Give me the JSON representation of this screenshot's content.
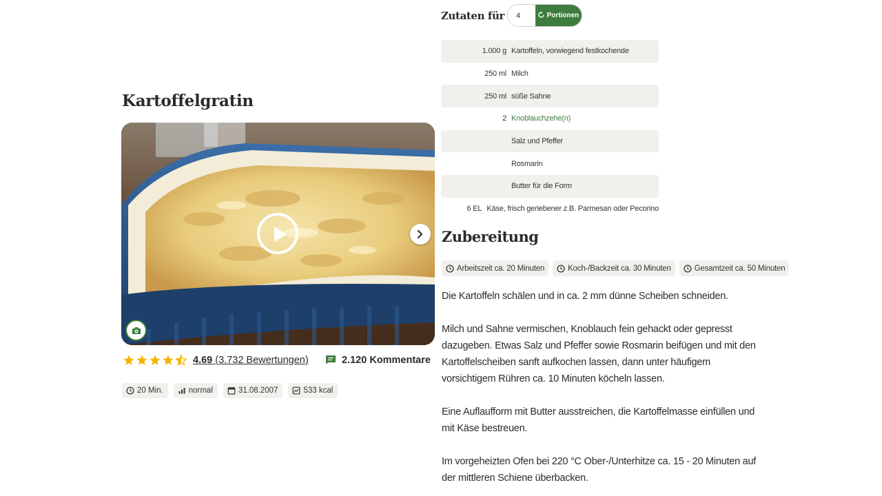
{
  "recipe": {
    "title": "Kartoffelgratin",
    "rating": {
      "average": "4.69",
      "count_text": "(3.732 Bewertungen)",
      "stars": 4.5
    },
    "comments_text": "2.120 Kommentare",
    "meta": [
      {
        "icon": "clock-icon",
        "text": "20 Min."
      },
      {
        "icon": "difficulty-icon",
        "text": "normal"
      },
      {
        "icon": "calendar-icon",
        "text": "31.08.2007"
      },
      {
        "icon": "calories-icon",
        "text": "533 kcal"
      }
    ]
  },
  "servings": {
    "label": "Zutaten für",
    "value": "4",
    "button_label": "Portionen"
  },
  "ingredients": [
    {
      "amount": "1.000 g",
      "name": "Kartoffeln, vorwiegend festkochende",
      "link": false
    },
    {
      "amount": "250 ml",
      "name": "Milch",
      "link": false
    },
    {
      "amount": "250 ml",
      "name": "süße Sahne",
      "link": false
    },
    {
      "amount": "2",
      "name": "Knoblauchzehe(n)",
      "link": true
    },
    {
      "amount": "",
      "name": "Salz und Pfeffer",
      "link": false
    },
    {
      "amount": "",
      "name": "Rosmarin",
      "link": false
    },
    {
      "amount": "",
      "name": "Butter für die Form",
      "link": false
    },
    {
      "amount": "6 EL",
      "name": "Käse, frisch geriebener z.B. Parmesan oder Pecorino",
      "link": false
    }
  ],
  "preparation": {
    "title": "Zubereitung",
    "times": [
      "Arbeitszeit ca. 20 Minuten",
      "Koch-/Backzeit ca. 30 Minuten",
      "Gesamtzeit ca. 50 Minuten"
    ],
    "steps": [
      "Die Kartoffeln schälen und in ca. 2 mm dünne Scheiben schneiden.",
      "Milch und Sahne vermischen, Knoblauch fein gehackt oder gepresst dazugeben. Etwas Salz und Pfeffer sowie Rosmarin beifügen und mit den Kartoffelscheiben sanft aufkochen lassen, dann unter häufigem vorsichtigem Rühren ca. 10 Minuten köcheln lassen.",
      "Eine Auflaufform mit Butter ausstreichen, die Kartoffelmasse einfüllen und mit Käse bestreuen.",
      "Im vorgeheizten Ofen bei 220 °C Ober-/Unterhitze ca. 15 - 20 Minuten auf der mittleren Schiene überbacken."
    ]
  },
  "colors": {
    "brand_green": "#3d7c3e",
    "star": "#f5b400",
    "chip_bg": "#f1f0ec"
  }
}
